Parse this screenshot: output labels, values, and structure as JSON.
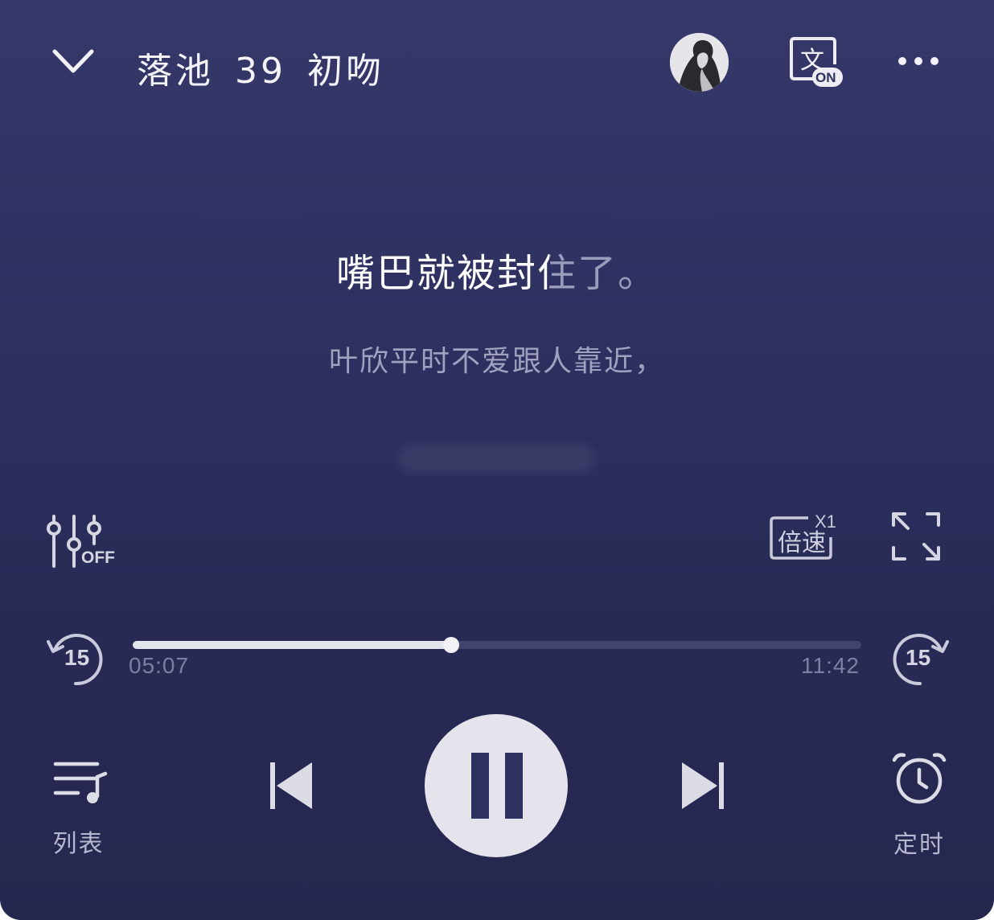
{
  "header": {
    "title_parts": [
      "落池",
      "39",
      "初吻"
    ],
    "subtitle_toggle_char": "文",
    "subtitle_toggle_state": "ON"
  },
  "lyrics": {
    "current_sung": "嘴巴就被封",
    "current_partial": "住",
    "current_rest": "了。",
    "next": "叶欣平时不爱跟人靠近，"
  },
  "controls": {
    "eq_state": "OFF",
    "speed_label": "倍速",
    "speed_value": "X1",
    "rewind_seconds": "15",
    "forward_seconds": "15"
  },
  "progress": {
    "elapsed": "05:07",
    "total": "11:42",
    "fraction": 0.437
  },
  "bottom": {
    "playlist_label": "列表",
    "timer_label": "定时"
  },
  "colors": {
    "background_top": "#36386a",
    "background_bottom": "#25274f",
    "accent": "#e5e4ec"
  },
  "icons": [
    "chevron-down-icon",
    "avatar",
    "subtitle-icon",
    "more-icon",
    "equalizer-icon",
    "speed-icon",
    "fullscreen-icon",
    "rewind-15-icon",
    "forward-15-icon",
    "playlist-icon",
    "previous-icon",
    "pause-icon",
    "next-icon",
    "alarm-clock-icon"
  ]
}
